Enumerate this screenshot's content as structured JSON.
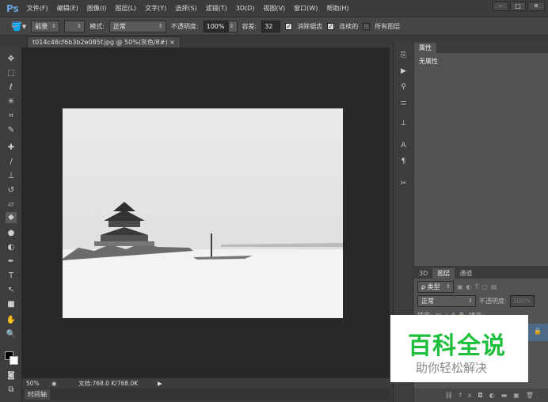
{
  "app": {
    "logo": "Ps"
  },
  "menu": [
    "文件(F)",
    "编辑(E)",
    "图像(I)",
    "图层(L)",
    "文字(Y)",
    "选择(S)",
    "滤镜(T)",
    "3D(D)",
    "视图(V)",
    "窗口(W)",
    "帮助(H)"
  ],
  "window_controls": {
    "minimize": "–",
    "maximize": "□",
    "close": "✕"
  },
  "options": {
    "fill_source": "前景",
    "mode_label": "模式:",
    "mode_value": "正常",
    "opacity_label": "不透明度:",
    "opacity_value": "100%",
    "tolerance_label": "容差:",
    "tolerance_value": "32",
    "antialias": "消除锯齿",
    "contiguous": "连续的",
    "all_layers": "所有图层"
  },
  "document": {
    "tab_title": "t014c48cf6b3b2e085f.jpg @ 50%(灰色/8#)",
    "close": "×"
  },
  "status": {
    "zoom": "50%",
    "doc_info": "文档:768.0 K/768.0K",
    "arrow": "▶"
  },
  "timeline": {
    "label": "时间轴"
  },
  "properties": {
    "tab": "属性",
    "content": "无属性"
  },
  "layers": {
    "tabs": [
      "3D",
      "图层",
      "通道"
    ],
    "filter": "ρ 类型",
    "blend_mode": "正常",
    "opacity_label": "不透明度:",
    "opacity_value": "100%",
    "lock_label": "锁定:",
    "fill_label": "填充:"
  },
  "watermark": {
    "title": "百科全说",
    "subtitle": "助你轻松解决"
  },
  "colors": {
    "accent": "#6aa3e0",
    "watermark_green": "#1dbf3c",
    "layer_selected": "#4e6a88"
  }
}
